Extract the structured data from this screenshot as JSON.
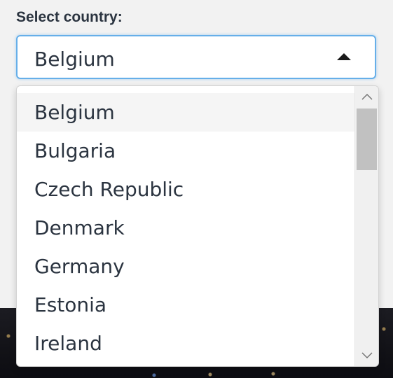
{
  "field": {
    "label": "Select country:",
    "selected_value": "Belgium"
  },
  "dropdown": {
    "options": [
      {
        "label": "Belgium",
        "active": true
      },
      {
        "label": "Bulgaria",
        "active": false
      },
      {
        "label": "Czech Republic",
        "active": false
      },
      {
        "label": "Denmark",
        "active": false
      },
      {
        "label": "Germany",
        "active": false
      },
      {
        "label": "Estonia",
        "active": false
      },
      {
        "label": "Ireland",
        "active": false
      }
    ]
  },
  "colors": {
    "focus_border": "#66afe9",
    "text": "#2b3440",
    "highlight_bg": "#f5f5f5",
    "scroll_thumb": "#c1c1c1"
  },
  "icons": {
    "caret": "caret-up-icon",
    "scroll_up": "chevron-up-icon",
    "scroll_down": "chevron-down-icon"
  }
}
